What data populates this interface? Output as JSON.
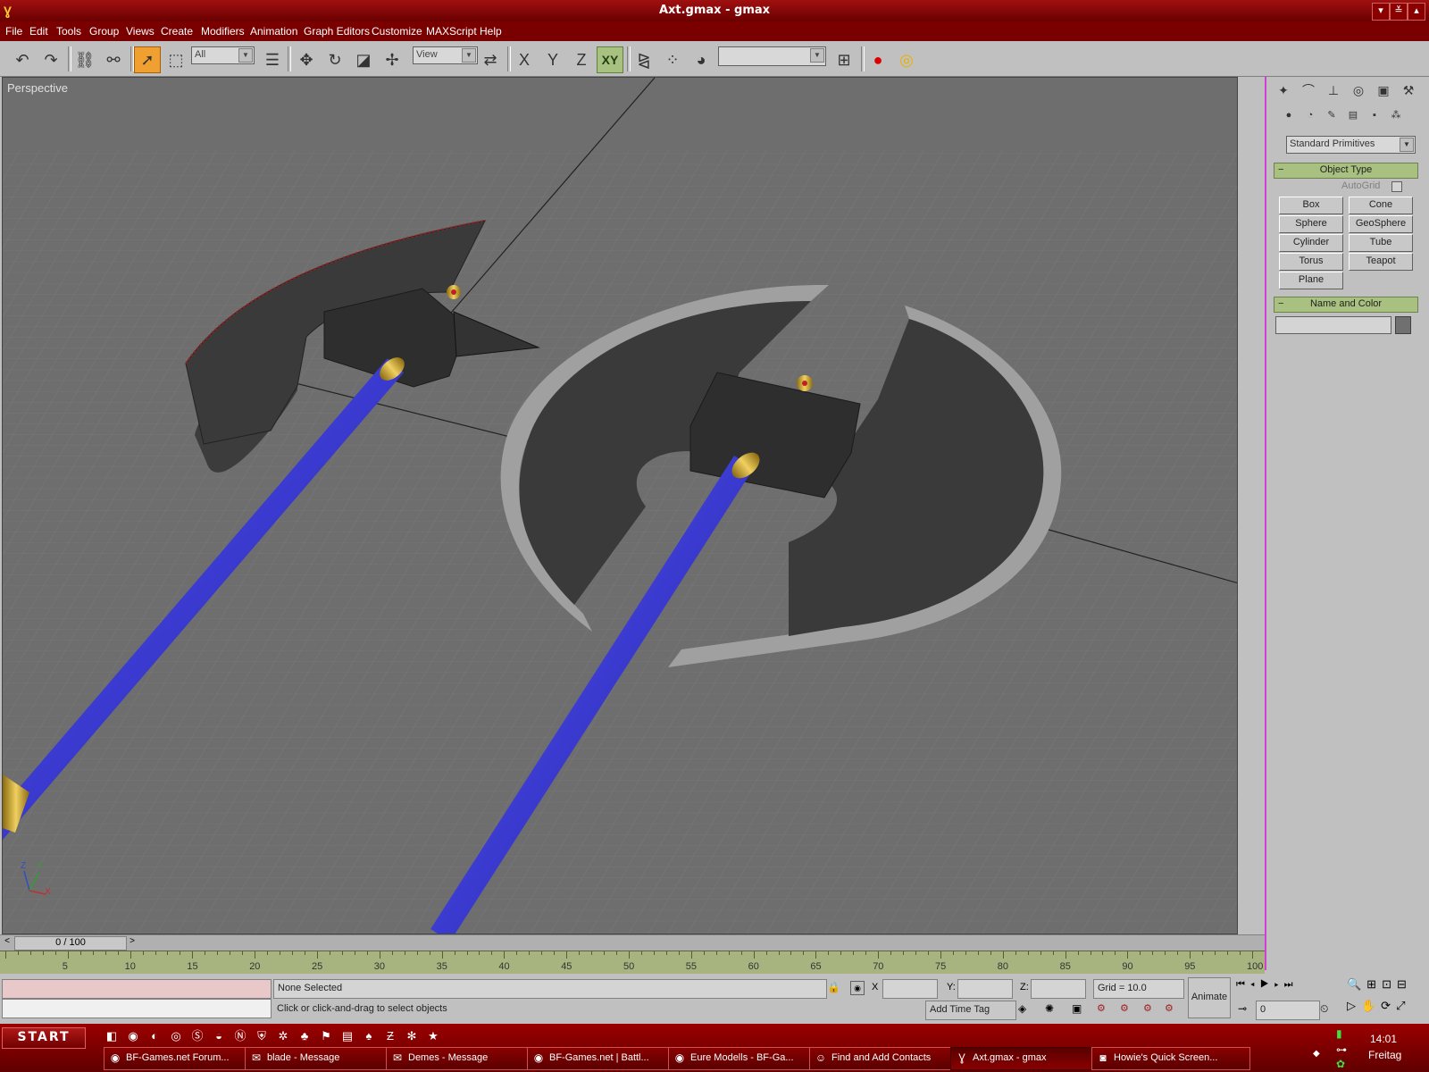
{
  "window": {
    "title": "Axt.gmax - gmax",
    "buttons": [
      "▾",
      "≚",
      "▴"
    ]
  },
  "menu": [
    "File",
    "Edit",
    "Tools",
    "Group",
    "Views",
    "Create",
    "Modifiers",
    "Animation",
    "Graph Editors",
    "Customize",
    "MAXScript",
    "Help"
  ],
  "toolbar": {
    "selection_filter": "All",
    "ref_coord": "View",
    "axis_x": "X",
    "axis_y": "Y",
    "axis_z": "Z",
    "axis_xy": "XY",
    "named_selection": ""
  },
  "viewport": {
    "label": "Perspective",
    "axis_tripod": {
      "z": "Z",
      "y": "Y",
      "x": "X"
    }
  },
  "command_panel": {
    "category": "Standard Primitives",
    "object_type_title": "Object Type",
    "autogrid": "AutoGrid",
    "primitives": [
      "Box",
      "Cone",
      "Sphere",
      "GeoSphere",
      "Cylinder",
      "Tube",
      "Torus",
      "Teapot",
      "Plane"
    ],
    "name_color_title": "Name and Color",
    "name_value": ""
  },
  "time": {
    "frame_readout": "0 / 100",
    "ticks": [
      "5",
      "10",
      "15",
      "20",
      "25",
      "30",
      "35",
      "40",
      "45",
      "50",
      "55",
      "60",
      "65",
      "70",
      "75",
      "80",
      "85",
      "90",
      "95",
      "100"
    ]
  },
  "status": {
    "selection": "None Selected",
    "prompt": "Click or click-and-drag to select objects",
    "x_label": "X",
    "y_label": "Y:",
    "z_label": "Z:",
    "grid": "Grid = 10.0",
    "add_time_tag": "Add Time Tag",
    "animate": "Animate",
    "current_frame": "0"
  },
  "taskbar": {
    "start": "START",
    "tasks": [
      "BF-Games.net Forum...",
      "blade - Message",
      "Demes - Message",
      "BF-Games.net | Battl...",
      "Eure Modells - BF-Ga...",
      "Find and Add Contacts",
      "Axt.gmax - gmax",
      "Howie's Quick Screen..."
    ],
    "clock_time": "14:01",
    "clock_day": "Freitag"
  }
}
